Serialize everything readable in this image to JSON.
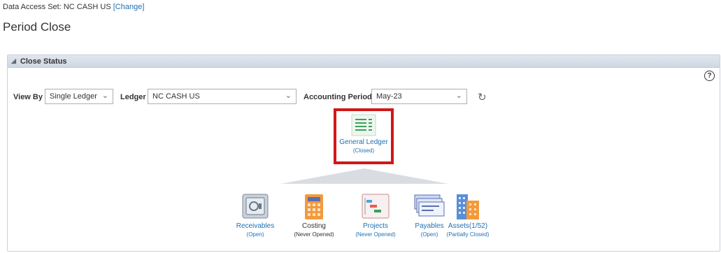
{
  "header": {
    "das_label": "Data Access Set:",
    "das_value": "NC CASH US",
    "change_link": "[Change]",
    "page_title": "Period Close"
  },
  "panel": {
    "title": "Close Status",
    "help": "?"
  },
  "filters": {
    "view_by_label": "View By",
    "view_by_value": "Single Ledger",
    "ledger_label": "Ledger",
    "ledger_value": "NC CASH US",
    "period_label": "Accounting Period",
    "period_value": "May-23"
  },
  "general_ledger": {
    "title": "General Ledger",
    "status": "(Closed)"
  },
  "subledgers": [
    {
      "title": "Receivables",
      "status": "(Open)"
    },
    {
      "title": "Costing",
      "status": "(Never Opened)"
    },
    {
      "title": "Projects",
      "status": "(Never Opened)"
    },
    {
      "title": "Payables",
      "status": "(Open)"
    },
    {
      "title": "Assets(1/52)",
      "status": "(Partially Closed)"
    }
  ],
  "colors": {
    "highlight": "#d11818",
    "link": "#1f6fb4"
  },
  "icons": [
    "general-ledger-icon",
    "receivables-icon",
    "costing-icon",
    "projects-icon",
    "payables-icon",
    "assets-icon",
    "refresh-icon",
    "help-icon"
  ]
}
